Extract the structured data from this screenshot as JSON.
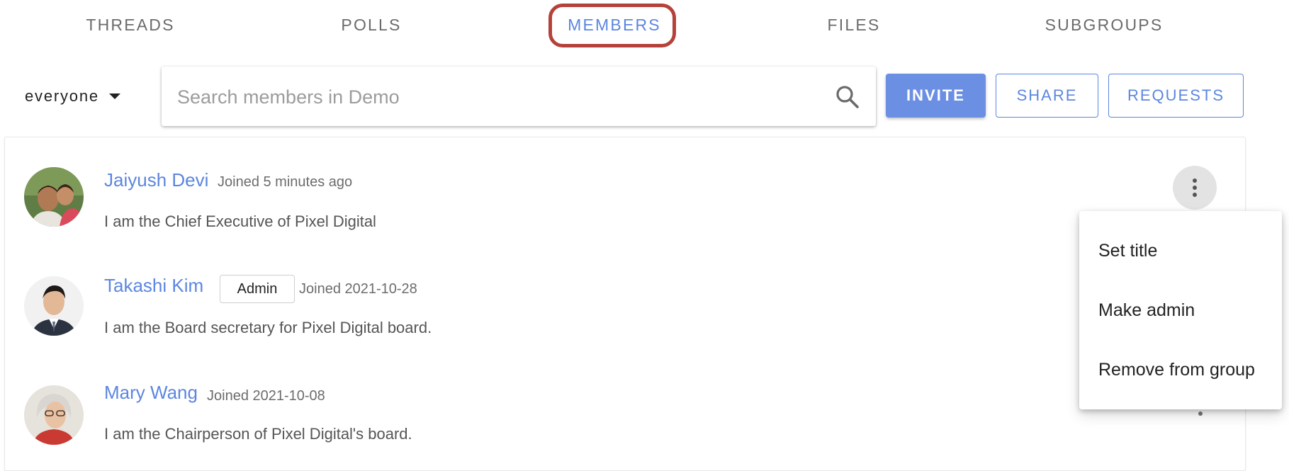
{
  "tabs": [
    {
      "label": "THREADS"
    },
    {
      "label": "POLLS"
    },
    {
      "label": "MEMBERS",
      "active": true
    },
    {
      "label": "FILES"
    },
    {
      "label": "SUBGROUPS"
    }
  ],
  "toolbar": {
    "filter_label": "everyone",
    "search_placeholder": "Search members in Demo",
    "invite_label": "INVITE",
    "share_label": "SHARE",
    "requests_label": "REQUESTS"
  },
  "members": [
    {
      "name": "Jaiyush Devi",
      "badge": "",
      "joined": "Joined 5 minutes ago",
      "bio": "I am the Chief Executive of Pixel Digital"
    },
    {
      "name": "Takashi Kim",
      "badge": "Admin",
      "joined": "Joined 2021-10-28",
      "bio": "I am the Board secretary for Pixel Digital board."
    },
    {
      "name": "Mary Wang",
      "badge": "",
      "joined": "Joined 2021-10-08",
      "bio": "I am the Chairperson of Pixel Digital's board."
    }
  ],
  "menu": {
    "items": [
      {
        "label": "Set title"
      },
      {
        "label": "Make admin"
      },
      {
        "label": "Remove from group"
      }
    ]
  },
  "colors": {
    "accent": "#5c86e0",
    "invite_bg": "#6b8fe3",
    "highlight_ring": "#b5423a"
  }
}
